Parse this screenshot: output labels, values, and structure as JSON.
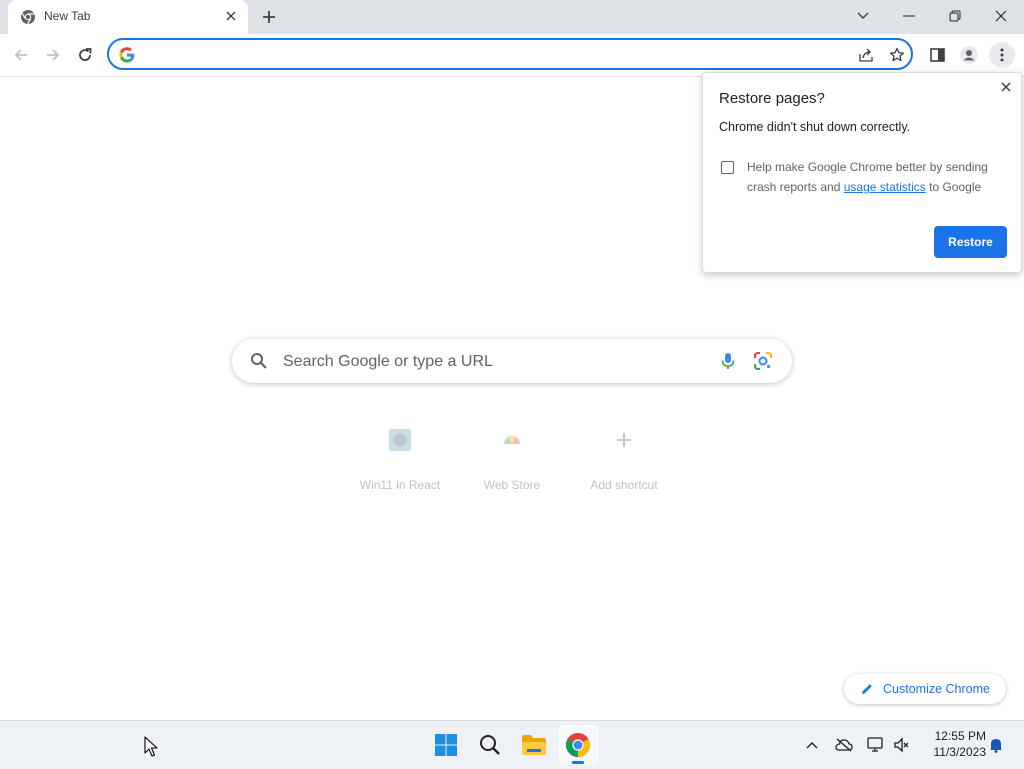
{
  "browser": {
    "tab": {
      "title": "New Tab",
      "favicon": "chrome-icon"
    },
    "omnibox": {
      "value": "",
      "leading_icon": "google-g-icon"
    }
  },
  "restore_bubble": {
    "title": "Restore pages?",
    "message": "Chrome didn't shut down correctly.",
    "checkbox_checked": false,
    "checkbox_text_before": "Help make Google Chrome better by sending crash reports and",
    "checkbox_link": "usage statistics",
    "checkbox_text_after": "to Google",
    "button_label": "Restore"
  },
  "ntp": {
    "search_placeholder": "Search Google or type a URL",
    "shortcuts": [
      {
        "label": "Win11 in React",
        "icon": "win11-react-icon"
      },
      {
        "label": "Web Store",
        "icon": "web-store-icon"
      },
      {
        "label": "Add shortcut",
        "icon": "plus-icon"
      }
    ],
    "customize_label": "Customize Chrome"
  },
  "taskbar": {
    "apps": [
      "windows-start-icon",
      "search-icon",
      "file-explorer-icon",
      "chrome-icon"
    ],
    "clock": {
      "time": "12:55 PM",
      "date": "11/3/2023"
    }
  },
  "colors": {
    "accent": "#1a73e8",
    "tabstrip": "#dee1e6",
    "taskbar": "#eef1f6"
  }
}
